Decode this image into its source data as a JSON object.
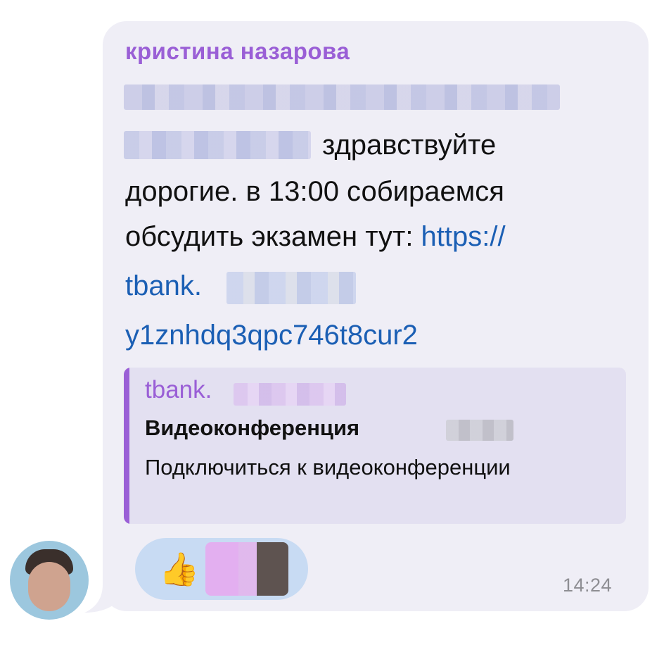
{
  "message": {
    "sender_name": "кристина назарова",
    "text_after_hidden": "здравствуйте",
    "line2": "дорогие. в 13:00 собираемся",
    "line3_text": "обсудить экзамен тут: ",
    "line3_link": "https://",
    "line4_link": "tbank.",
    "line5_link": "y1znhdq3qpc746t8cur2",
    "time": "14:24"
  },
  "link_preview": {
    "site": "tbank.",
    "title": "Видеоконференция",
    "description": "Подключиться к видеоконференции"
  },
  "reaction": {
    "emoji": "👍"
  },
  "icons": {
    "reaction_icon": "thumbs-up-icon"
  },
  "colors": {
    "bubble_bg": "#efeef6",
    "accent_purple": "#9a5fd6",
    "link_blue": "#1b5fb4",
    "preview_bg": "#e3e0f1",
    "reaction_bg": "#c8dbf3",
    "time_gray": "#8e8e93"
  }
}
